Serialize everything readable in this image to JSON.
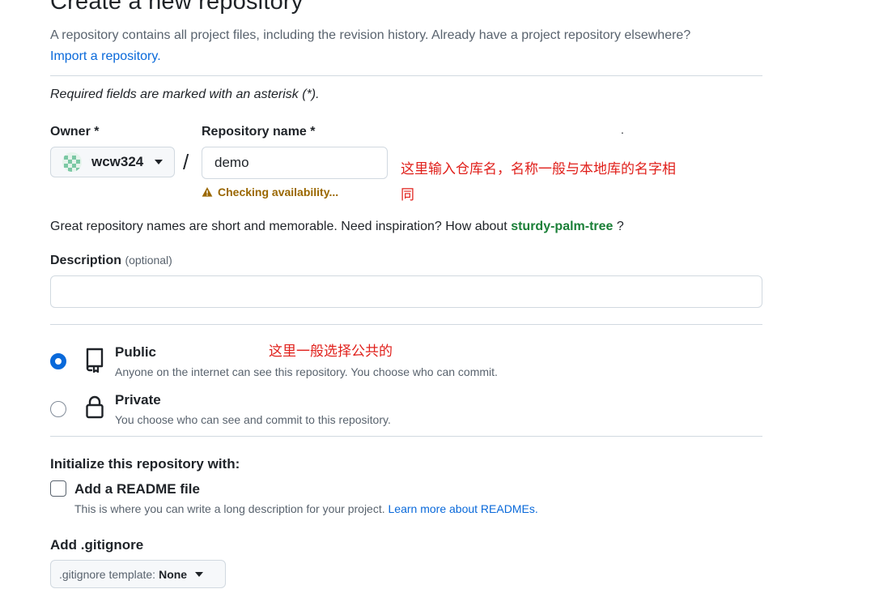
{
  "header": {
    "title": "Create a new repository",
    "subtitle": "A repository contains all project files, including the revision history. Already have a project repository elsewhere?",
    "import_link": "Import a repository."
  },
  "form": {
    "required_note": "Required fields are marked with an asterisk (*).",
    "owner_label": "Owner *",
    "owner_value": "wcw324",
    "separator": "/",
    "repo_label": "Repository name *",
    "repo_value": "demo",
    "checking_text": "Checking availability...",
    "suggestion_prefix": "Great repository names are short and memorable. Need inspiration? How about",
    "suggestion_name": "sturdy-palm-tree",
    "suggestion_suffix": "?",
    "description_label": "Description",
    "description_optional": "(optional)",
    "description_value": "",
    "visibility": {
      "public_title": "Public",
      "public_desc": "Anyone on the internet can see this repository. You choose who can commit.",
      "private_title": "Private",
      "private_desc": "You choose who can see and commit to this repository.",
      "selected": "Public"
    },
    "init_label": "Initialize this repository with:",
    "readme_label": "Add a README file",
    "readme_desc": "This is where you can write a long description for your project.",
    "readme_link": "Learn more about READMEs.",
    "readme_checked": false,
    "gitignore_label": "Add .gitignore",
    "gitignore_prefix": ".gitignore template:",
    "gitignore_value": "None"
  },
  "annotations": {
    "repo_note_line1": "这里输入仓库名，名称一般与本地库的名字相",
    "repo_note_line2": "同",
    "visibility_note": "这里一般选择公共的",
    "stray_dot": "."
  },
  "colors": {
    "link": "#0969da",
    "suggestion": "#1a7f37",
    "warning": "#9a6700",
    "annotation": "#e0201b",
    "radio_selected": "#0969da"
  },
  "icons": {
    "caret": "chevron-down-icon",
    "warning": "alert-icon",
    "public": "repo-icon",
    "private": "lock-icon"
  }
}
